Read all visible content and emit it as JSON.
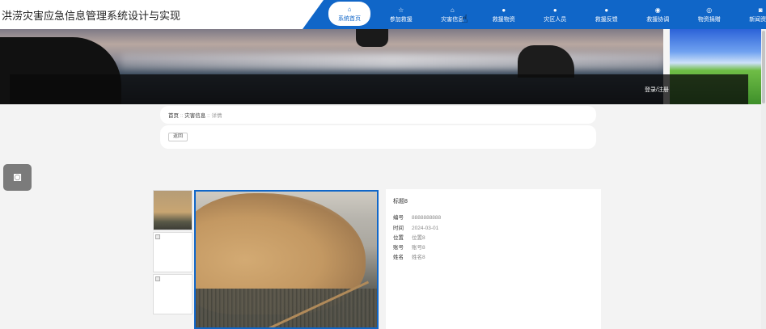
{
  "site_title": "洪涝灾害应急信息管理系统设计与实现",
  "nav": [
    {
      "label": "系统首页",
      "icon": "⌂",
      "active": true
    },
    {
      "label": "参加救援",
      "icon": "☆"
    },
    {
      "label": "灾害信息",
      "icon": "⌂"
    },
    {
      "label": "救援物资",
      "icon": "●"
    },
    {
      "label": "灾区人员",
      "icon": "●"
    },
    {
      "label": "救援反馈",
      "icon": "●"
    },
    {
      "label": "救援协调",
      "icon": "◉"
    },
    {
      "label": "物资捐赠",
      "icon": "◎"
    },
    {
      "label": "新闻资讯",
      "icon": "◙"
    }
  ],
  "banner": {
    "login_text": "登录/注册"
  },
  "breadcrumb": {
    "home": "首页",
    "sep": "::",
    "section": "灾害信息",
    "current": "详情"
  },
  "back_label": "返回",
  "detail": {
    "title": "标题8",
    "rows": [
      {
        "label": "编号",
        "value": "8888888888"
      },
      {
        "label": "时间",
        "value": "2024-03-01"
      },
      {
        "label": "位置",
        "value": "位置8"
      },
      {
        "label": "账号",
        "value": "账号8"
      },
      {
        "label": "姓名",
        "value": "姓名8"
      }
    ]
  }
}
